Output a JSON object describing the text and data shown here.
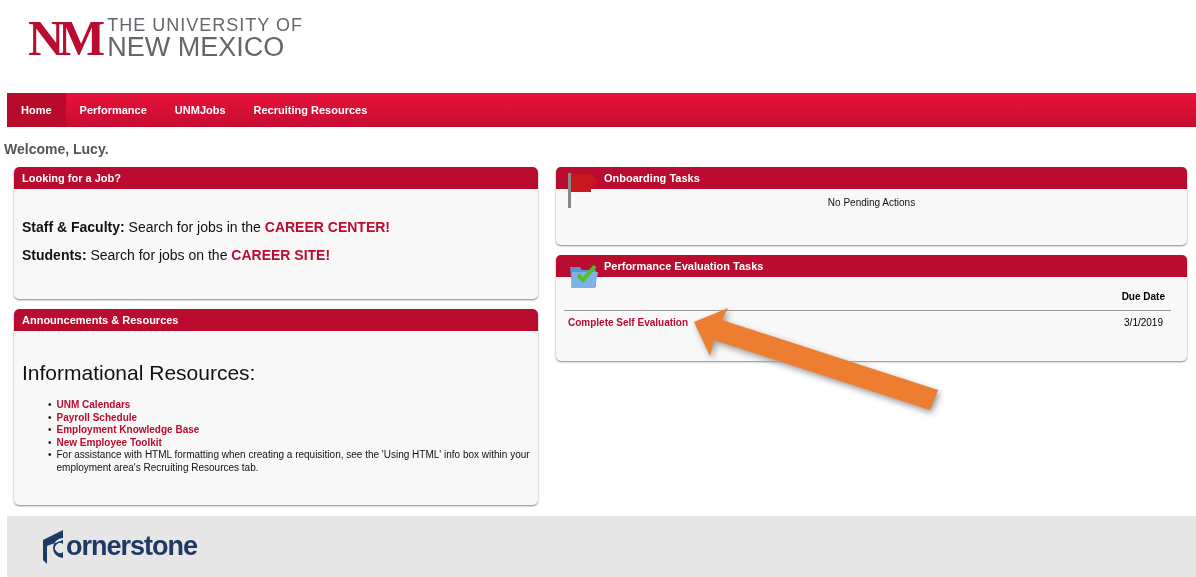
{
  "logo": {
    "monogram": "NM",
    "line_1": "THE UNIVERSITY OF",
    "line_2": "NEW MEXICO"
  },
  "nav": [
    {
      "label": "Home",
      "selected": true
    },
    {
      "label": "Performance",
      "selected": false
    },
    {
      "label": "UNMJobs",
      "selected": false
    },
    {
      "label": "Recruiting Resources",
      "selected": false
    }
  ],
  "welcome": "Welcome, Lucy.",
  "job_panel": {
    "title": "Looking for a Job?",
    "lines": [
      {
        "label": "Staff & Faculty:",
        "text": "Search for jobs in the",
        "link": "CAREER CENTER!"
      },
      {
        "label": "Students:",
        "text": "Search for jobs on the",
        "link": "CAREER SITE!"
      }
    ]
  },
  "announcements": {
    "title": "Announcements & Resources",
    "heading": "Informational Resources:",
    "items": [
      {
        "kind": "link",
        "bullet": "•",
        "text": "UNM Calendars"
      },
      {
        "kind": "link",
        "bullet": "•",
        "text": "Payroll Schedule"
      },
      {
        "kind": "link",
        "bullet": "•",
        "text": "Employment Knowledge Base"
      },
      {
        "kind": "link",
        "bullet": "•",
        "text": "New Employee Toolkit"
      },
      {
        "kind": "note",
        "bullet": "•",
        "text": "For assistance with HTML formatting when creating a requisition, see the 'Using HTML' info box within your employment area's Recruiting Resources tab."
      }
    ]
  },
  "onboarding": {
    "title": "Onboarding Tasks",
    "message": "No Pending Actions"
  },
  "evaluation": {
    "title": "Performance Evaluation Tasks",
    "column": "Due Date",
    "rows": [
      {
        "task": "Complete Self Evaluation",
        "due": "3/1/2019"
      }
    ]
  },
  "footer": {
    "logo_text": "ornerstone"
  }
}
